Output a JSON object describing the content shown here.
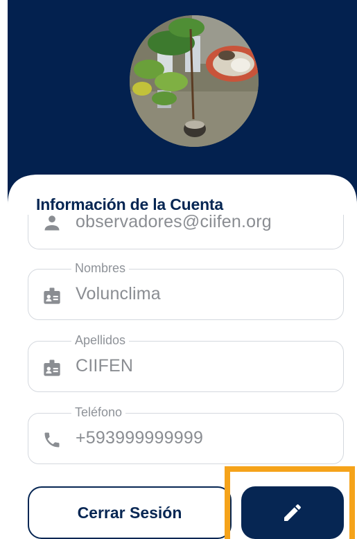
{
  "profile": {
    "avatar_icon": "profile-photo-plants"
  },
  "account": {
    "section_title": "Información de la Cuenta",
    "email": {
      "value": "observadores@ciifen.org",
      "icon": "person-icon"
    },
    "first_name": {
      "label": "Nombres",
      "value": "Volunclima",
      "icon": "badge-icon"
    },
    "last_name": {
      "label": "Apellidos",
      "value": "CIIFEN",
      "icon": "badge-icon"
    },
    "phone": {
      "label": "Teléfono",
      "value": "+593999999999",
      "icon": "phone-icon"
    }
  },
  "actions": {
    "logout_label": "Cerrar Sesión",
    "edit_icon": "pencil-icon"
  },
  "colors": {
    "header": "#03214f",
    "primary": "#062653",
    "highlight": "#f5a31a",
    "border": "#d4d8de"
  }
}
